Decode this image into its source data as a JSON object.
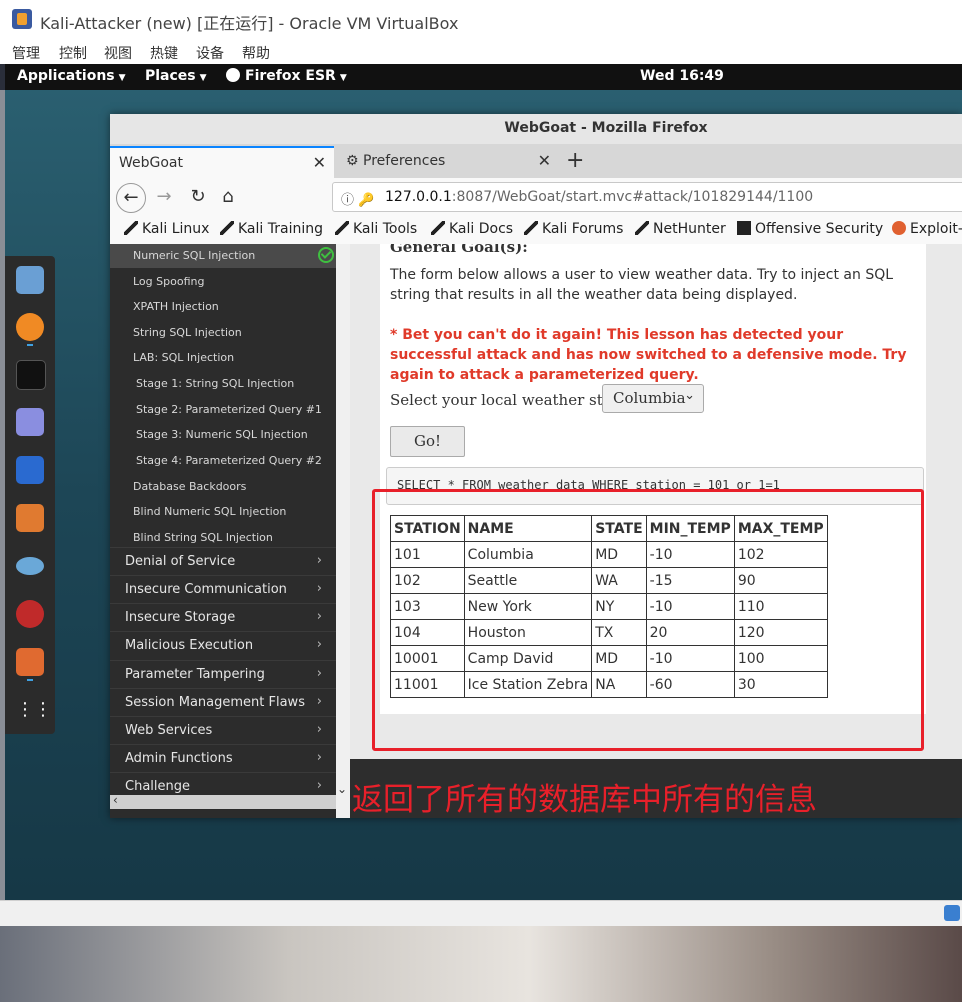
{
  "vbox": {
    "title": "Kali-Attacker (new) [正在运行] - Oracle VM VirtualBox",
    "menu": [
      "管理",
      "控制",
      "视图",
      "热键",
      "设备",
      "帮助"
    ]
  },
  "kali_panel": {
    "applications": "Applications",
    "places": "Places",
    "firefox": "Firefox ESR",
    "clock": "Wed 16:49"
  },
  "firefox": {
    "window_title": "WebGoat - Mozilla Firefox",
    "tabs": [
      {
        "label": "WebGoat",
        "active": true
      },
      {
        "label": "Preferences",
        "active": false
      }
    ],
    "url_host": "127.0.0.1",
    "url_rest": ":8087/WebGoat/start.mvc#attack/101829144/1100",
    "bookmarks": [
      "Kali Linux",
      "Kali Training",
      "Kali Tools",
      "Kali Docs",
      "Kali Forums",
      "NetHunter",
      "Offensive Security",
      "Exploit-D"
    ]
  },
  "sidebar": {
    "sub_items": [
      "Numeric SQL Injection",
      "Log Spoofing",
      "XPATH Injection",
      "String SQL Injection",
      "LAB: SQL Injection",
      "Stage 1: String SQL Injection",
      "Stage 2: Parameterized Query #1",
      "Stage 3: Numeric SQL Injection",
      "Stage 4: Parameterized Query #2",
      "Database Backdoors",
      "Blind Numeric SQL Injection",
      "Blind String SQL Injection"
    ],
    "categories": [
      "Denial of Service",
      "Insecure Communication",
      "Insecure Storage",
      "Malicious Execution",
      "Parameter Tampering",
      "Session Management Flaws",
      "Web Services",
      "Admin Functions",
      "Challenge"
    ],
    "chevron": "›"
  },
  "lesson": {
    "goal_heading": "General Goal(s):",
    "goal_text": "The form below allows a user to view weather data. Try to inject an SQL string that results in all the weather data being displayed.",
    "warning": "* Bet you can't do it again! This lesson has detected your successful attack and has now switched to a defensive mode. Try again to attack a parameterized query.",
    "select_label": "Select your local weather station:",
    "select_value": "Columbia",
    "go_button": "Go!",
    "sql_query": "SELECT * FROM weather_data WHERE station = 101 or 1=1",
    "table": {
      "headers": [
        "STATION",
        "NAME",
        "STATE",
        "MIN_TEMP",
        "MAX_TEMP"
      ],
      "rows": [
        [
          "101",
          "Columbia",
          "MD",
          "-10",
          "102"
        ],
        [
          "102",
          "Seattle",
          "WA",
          "-15",
          "90"
        ],
        [
          "103",
          "New York",
          "NY",
          "-10",
          "110"
        ],
        [
          "104",
          "Houston",
          "TX",
          "20",
          "120"
        ],
        [
          "10001",
          "Camp David",
          "MD",
          "-10",
          "100"
        ],
        [
          "11001",
          "Ice Station Zebra",
          "NA",
          "-60",
          "30"
        ]
      ]
    }
  },
  "annotation": "返回了所有的数据库中所有的信息",
  "colors": {
    "annotation_red": "#e8202a",
    "warning_red": "#e03a2a",
    "sidebar_bg": "#2c2c2c",
    "tab_accent": "#0a84ff"
  }
}
